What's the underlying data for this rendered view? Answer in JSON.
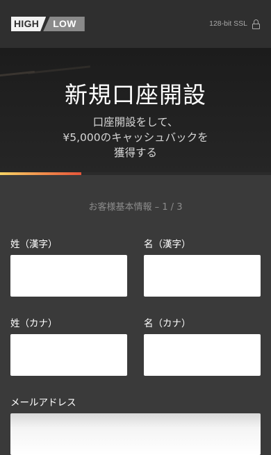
{
  "header": {
    "logo_high": "HIGH",
    "logo_low": "LOW",
    "ssl_text": "128-bit SSL",
    "ssl_icon": "lock-icon"
  },
  "hero": {
    "title": "新規口座開設",
    "subtitle_lines": [
      "口座開設をして、",
      "¥5,000のキャッシュバックを",
      "獲得する"
    ]
  },
  "progress": {
    "fraction": 0.3
  },
  "form": {
    "step_label": "お客様基本情報 – 1 / 3",
    "fields": {
      "last_name_kanji": {
        "label": "姓（漢字）",
        "value": ""
      },
      "first_name_kanji": {
        "label": "名（漢字）",
        "value": ""
      },
      "last_name_kana": {
        "label": "姓（カナ）",
        "value": ""
      },
      "first_name_kana": {
        "label": "名（カナ）",
        "value": ""
      },
      "email": {
        "label": "メールアドレス",
        "value": ""
      }
    }
  }
}
